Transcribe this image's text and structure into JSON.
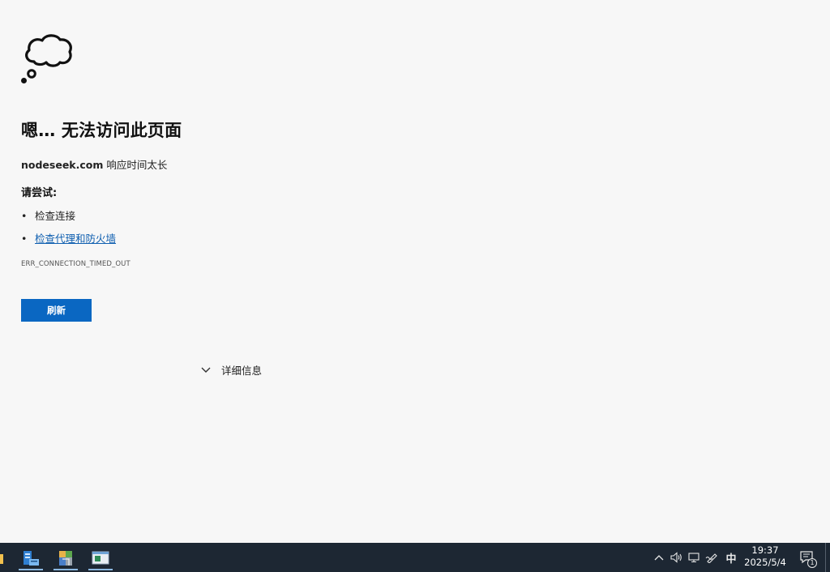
{
  "error_page": {
    "title": "嗯… 无法访问此页面",
    "host": "nodeseek.com",
    "message": " 响应时间太长",
    "try_heading": "请尝试:",
    "suggestions": [
      {
        "bullet": "•",
        "text": "检查连接",
        "is_link": false
      },
      {
        "bullet": "•",
        "text": "检查代理和防火墙",
        "is_link": true
      }
    ],
    "error_code": "ERR_CONNECTION_TIMED_OUT",
    "refresh_label": "刷新",
    "details_label": "详细信息",
    "link_color": "#0f5fb0",
    "button_color": "#0a67c2"
  },
  "taskbar": {
    "tray": {
      "chevron_icon": "chevron-up-icon",
      "volume_icon": "volume-icon",
      "network_icon": "network-icon",
      "pen_icon": "pen-icon",
      "ime_label": "中",
      "time": "19:37",
      "date": "2025/5/4",
      "notification_count": "1"
    },
    "apps": [
      "folder-icon",
      "server-manager-icon",
      "app-icon",
      "window-app-icon"
    ]
  }
}
